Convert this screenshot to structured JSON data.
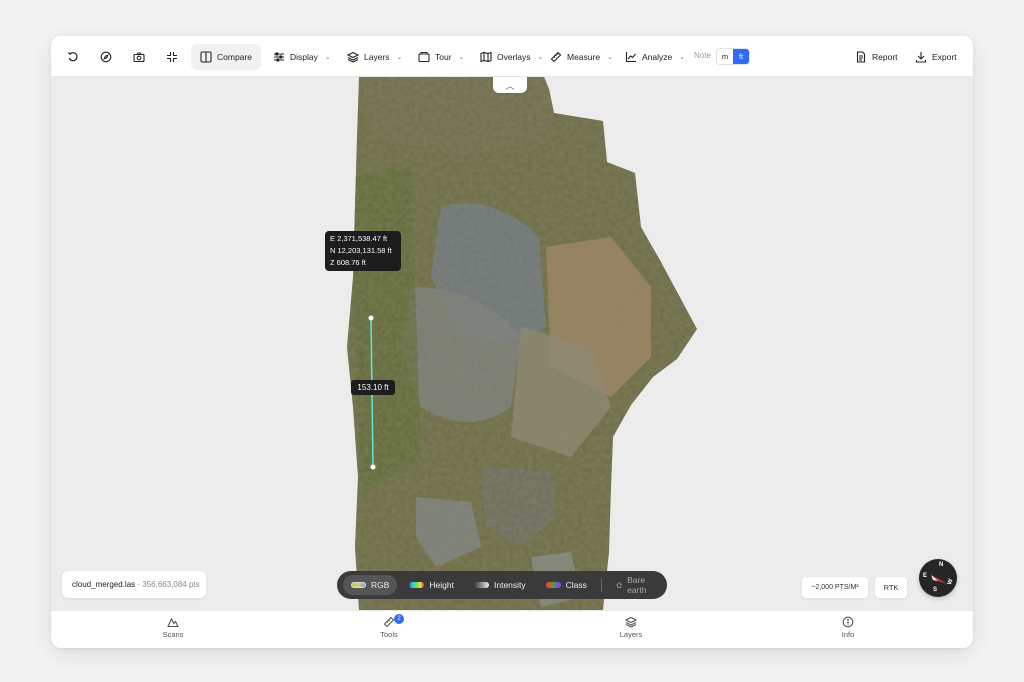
{
  "toolbar": {
    "compare_label": "Compare",
    "display_label": "Display",
    "layers_label": "Layers",
    "tour_label": "Tour",
    "overlays_label": "Overlays",
    "measure_label": "Measure",
    "analyze_label": "Analyze",
    "note_label": "Note",
    "unit_m": "m",
    "unit_ft": "ft",
    "report_label": "Report",
    "export_label": "Export"
  },
  "viewport": {
    "coord": {
      "e": "E 2,371,538.47 ft",
      "n": "N 12,203,131.58 ft",
      "z": "Z 608.76 ft"
    },
    "measurement": "153.10 ft",
    "file_name": "cloud_merged.las",
    "file_points": " · 356,663,084 pts",
    "density": "~2,000 PTS/M²",
    "rtk": "RTK",
    "compass": {
      "n": "N",
      "e": "E",
      "s": "S",
      "w": "W"
    },
    "color_modes": {
      "rgb": "RGB",
      "height": "Height",
      "intensity": "Intensity",
      "class": "Class",
      "bare_earth": "Bare earth"
    },
    "measure_color": "#5fe3e6"
  },
  "bottomnav": {
    "scans": "Scans",
    "tools": "Tools",
    "tools_badge": "2",
    "layers": "Layers",
    "info": "Info"
  },
  "colors": {
    "accent": "#2f6bf5"
  }
}
